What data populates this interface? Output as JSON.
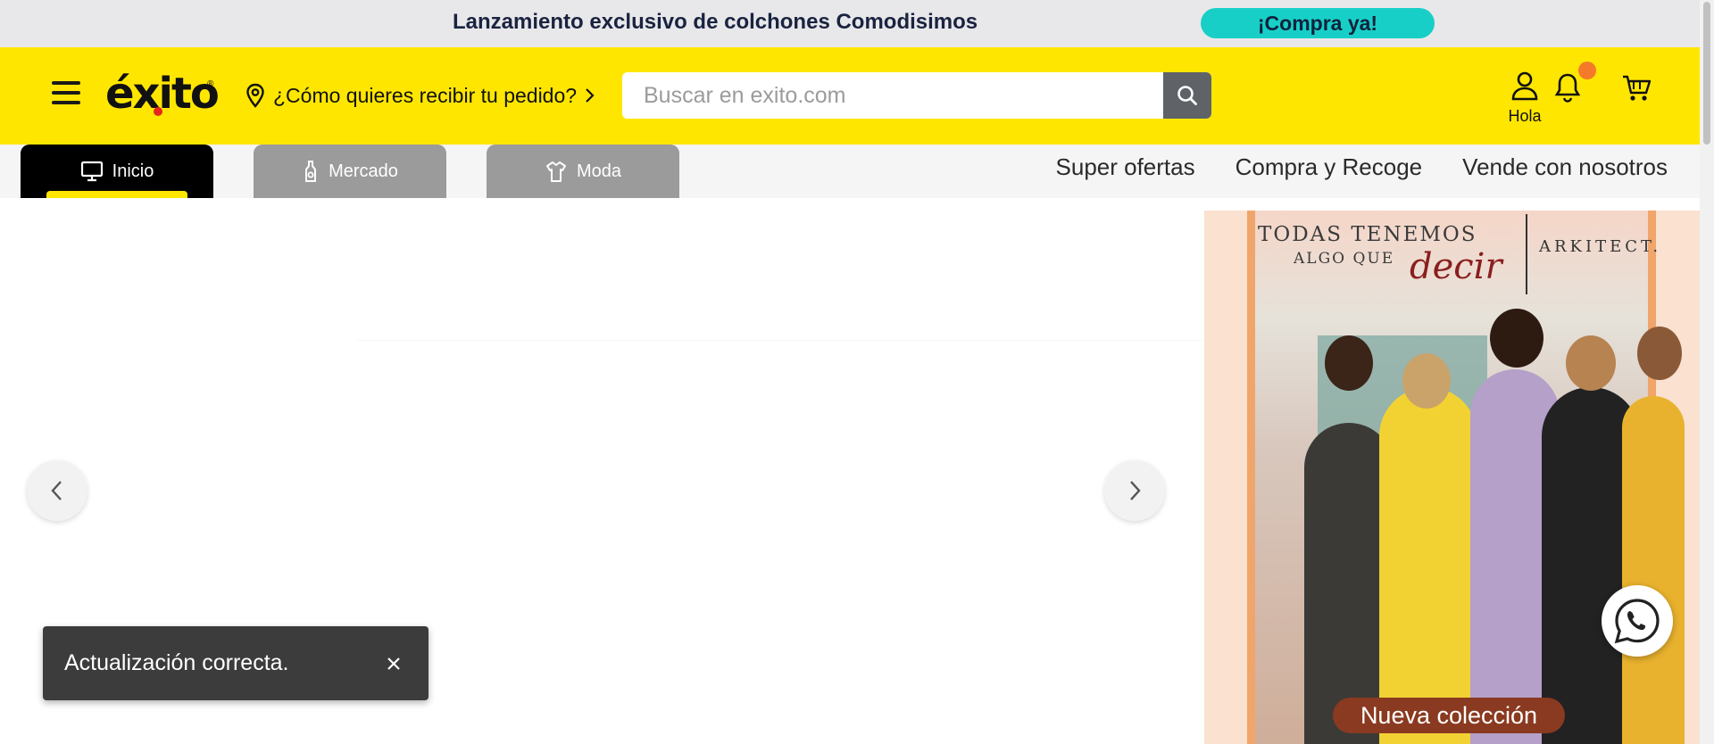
{
  "promo": {
    "text": "Lanzamiento exclusivo de colchones Comodisimos",
    "cta": "¡Compra ya!"
  },
  "header": {
    "logo": "éxito",
    "logo_mark": "®",
    "delivery_text": "¿Cómo quieres recibir tu pedido?",
    "search_placeholder": "Buscar en exito.com",
    "account_label": "Hola"
  },
  "tabs": [
    {
      "label": "Inicio",
      "icon": "monitor-icon"
    },
    {
      "label": "Mercado",
      "icon": "bottle-icon"
    },
    {
      "label": "Moda",
      "icon": "shirt-icon"
    }
  ],
  "nav_links": [
    "Super ofertas",
    "Compra y Recoge",
    "Vende con nosotros"
  ],
  "banner": {
    "line1": "TODAS TENEMOS",
    "line2": "ALGO QUE",
    "script": "decir",
    "brand": "ARKITECT.",
    "cta": "Nueva colección"
  },
  "toast": {
    "message": "Actualización correcta."
  },
  "colors": {
    "brand_yellow": "#ffe600",
    "promo_teal": "#18cfc7",
    "notification": "#f47a2a"
  }
}
